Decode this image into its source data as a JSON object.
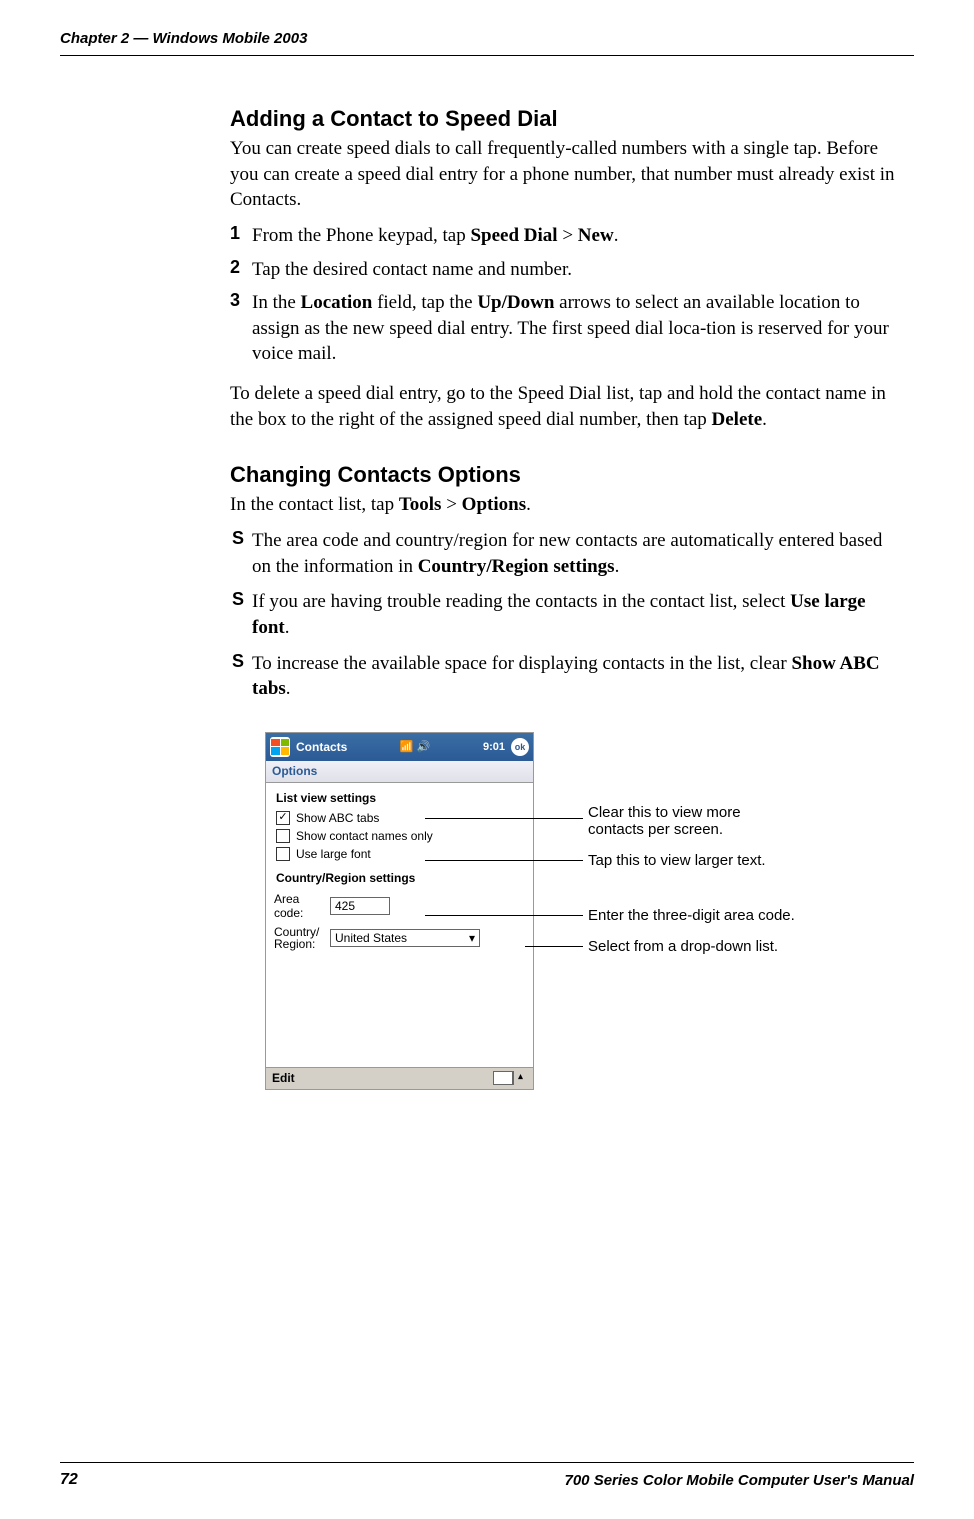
{
  "header": {
    "chapter": "Chapter 2",
    "sep": "—",
    "title": "Windows Mobile 2003"
  },
  "section1": {
    "title": "Adding a Contact to Speed Dial",
    "intro": "You can create speed dials to call frequently-called numbers with a single tap. Before you can create a speed dial entry for a phone number, that number must already exist in Contacts.",
    "steps": [
      {
        "n": "1",
        "pre": "From the Phone keypad, tap ",
        "b1": "Speed Dial",
        "mid1": " > ",
        "b2": "New",
        "end": "."
      },
      {
        "n": "2",
        "text": "Tap the desired contact name and number."
      },
      {
        "n": "3",
        "pre": "In the ",
        "b1": "Location",
        "mid1": " field, tap the ",
        "b2": "Up/Down",
        "end": " arrows to select an available location to assign as the new speed dial entry. The first speed dial loca-tion is reserved for your voice mail."
      }
    ],
    "outro_pre": "To delete a speed dial entry, go to the Speed Dial list, tap and hold the contact name in the box to the right of the assigned speed dial number, then tap ",
    "outro_bold": "Delete",
    "outro_end": "."
  },
  "section2": {
    "title": "Changing Contacts Options",
    "intro_pre": "In the contact list, tap ",
    "intro_b1": "Tools",
    "intro_mid": " > ",
    "intro_b2": "Options",
    "intro_end": ".",
    "bullets": [
      {
        "pre": "The area code and country/region for new contacts are automatically entered based on the information in ",
        "bold": "Country/Region settings",
        "end": "."
      },
      {
        "pre": "If you are having trouble reading the contacts in the contact list, select ",
        "bold": "Use large font",
        "end": "."
      },
      {
        "pre": "To increase the available space for displaying contacts in the list, clear ",
        "bold": "Show ABC tabs",
        "end": "."
      }
    ]
  },
  "screenshot": {
    "app_title": "Contacts",
    "time": "9:01",
    "ok": "ok",
    "subheader": "Options",
    "section1": "List view settings",
    "cb1": "Show ABC tabs",
    "cb1_checked": "✓",
    "cb2": "Show contact names only",
    "cb3": "Use large font",
    "section2": "Country/Region settings",
    "area_label": "Area code:",
    "area_value": "425",
    "country_label": "Country/\nRegion:",
    "country_value": "United States",
    "dropdown_arrow": "▾",
    "footer_edit": "Edit",
    "footer_arrow": "▴"
  },
  "annotations": {
    "a1": "Clear this to view more contacts per screen.",
    "a2": "Tap this to view larger text.",
    "a3": "Enter the three-digit area code.",
    "a4": "Select from a drop-down list."
  },
  "footer": {
    "page": "72",
    "manual": "700 Series Color Mobile Computer User's Manual"
  }
}
